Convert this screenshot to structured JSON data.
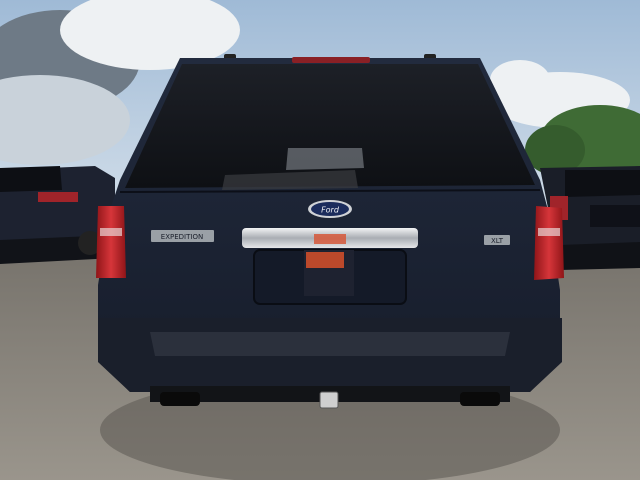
{
  "scene": {
    "subject": "ford-expedition-rear",
    "colors": {
      "sky": "#b9cfe4",
      "cloud": "#e8ecef",
      "ground": "#8a857d",
      "body": "#1c2436",
      "glass": "#14161c",
      "chrome": "#d9dbde",
      "taillight": "#c0262b",
      "trees": "#3f6b35"
    }
  },
  "vehicle": {
    "brand_badge": "Ford",
    "model_badge": "EXPEDITION",
    "trim_badge": "XLT"
  }
}
